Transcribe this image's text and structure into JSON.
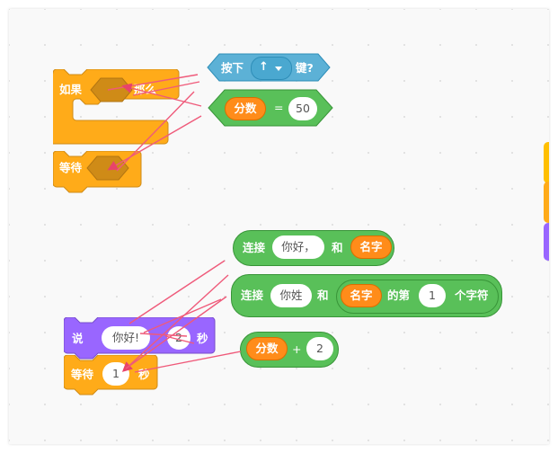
{
  "colors": {
    "control": "#ffab19",
    "looks": "#9966ff",
    "operators": "#59c059",
    "sensing": "#5cb1d6",
    "variables": "#ff8c1a"
  },
  "if_block": {
    "if_label": "如果",
    "then_label": "那么"
  },
  "wait_block_1": {
    "label": "等待"
  },
  "key_pressed": {
    "label": "按下",
    "key_value": "↑",
    "dropdown_icon": "triangle-down",
    "suffix": "键?"
  },
  "equals_block": {
    "variable": "分数",
    "operator": "=",
    "value": "50"
  },
  "join1": {
    "label": "连接",
    "value": "你好，",
    "and_label": "和",
    "variable": "名字"
  },
  "join2": {
    "label": "连接",
    "value": "你姓",
    "and_label": "和",
    "variable": "名字",
    "of_label": "的第",
    "index": "1",
    "suffix": "个字符"
  },
  "say_block": {
    "label": "说",
    "message": "你好!",
    "secs_value": "2",
    "secs_label": "秒"
  },
  "wait_block_2": {
    "label": "等待",
    "value": "1",
    "secs_label": "秒"
  },
  "add_block": {
    "variable": "分数",
    "operator": "+",
    "value": "2"
  }
}
